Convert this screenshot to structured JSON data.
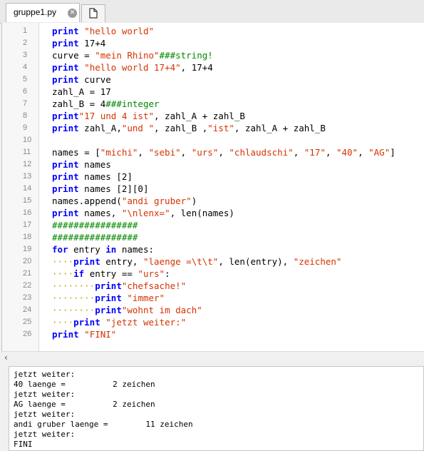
{
  "tabs": [
    {
      "label": "gruppe1.py",
      "close_icon": "close-icon"
    }
  ],
  "new_tab_icon": "new-document-icon",
  "editor": {
    "lines": [
      {
        "n": "1",
        "indent": "",
        "tokens": [
          [
            "kw",
            "print"
          ],
          [
            "pl",
            " "
          ],
          [
            "str",
            "\"hello world\""
          ]
        ]
      },
      {
        "n": "2",
        "indent": "",
        "tokens": [
          [
            "kw",
            "print"
          ],
          [
            "pl",
            " 17+4"
          ]
        ]
      },
      {
        "n": "3",
        "indent": "",
        "tokens": [
          [
            "pl",
            "curve = "
          ],
          [
            "str",
            "\"mein Rhino\""
          ],
          [
            "cmt",
            "###string!"
          ]
        ]
      },
      {
        "n": "4",
        "indent": "",
        "tokens": [
          [
            "kw",
            "print"
          ],
          [
            "pl",
            " "
          ],
          [
            "str",
            "\"hello world 17+4\""
          ],
          [
            "pl",
            ", 17+4"
          ]
        ]
      },
      {
        "n": "5",
        "indent": "",
        "tokens": [
          [
            "kw",
            "print"
          ],
          [
            "pl",
            " curve"
          ]
        ]
      },
      {
        "n": "6",
        "indent": "",
        "tokens": [
          [
            "pl",
            "zahl_A = 17"
          ]
        ]
      },
      {
        "n": "7",
        "indent": "",
        "tokens": [
          [
            "pl",
            "zahl_B = 4"
          ],
          [
            "cmt",
            "###integer"
          ]
        ]
      },
      {
        "n": "8",
        "indent": "",
        "tokens": [
          [
            "kw",
            "print"
          ],
          [
            "str",
            "\"17 und 4 ist\""
          ],
          [
            "pl",
            ", zahl_A + zahl_B"
          ]
        ]
      },
      {
        "n": "9",
        "indent": "",
        "tokens": [
          [
            "kw",
            "print"
          ],
          [
            "pl",
            " zahl_A,"
          ],
          [
            "str",
            "\"und \""
          ],
          [
            "pl",
            ", zahl_B ,"
          ],
          [
            "str",
            "\"ist\""
          ],
          [
            "pl",
            ", zahl_A + zahl_B"
          ]
        ]
      },
      {
        "n": "10",
        "indent": "",
        "tokens": []
      },
      {
        "n": "11",
        "indent": "",
        "tokens": [
          [
            "pl",
            "names = ["
          ],
          [
            "str",
            "\"michi\""
          ],
          [
            "pl",
            ", "
          ],
          [
            "str",
            "\"sebi\""
          ],
          [
            "pl",
            ", "
          ],
          [
            "str",
            "\"urs\""
          ],
          [
            "pl",
            ", "
          ],
          [
            "str",
            "\"chlaudschi\""
          ],
          [
            "pl",
            ", "
          ],
          [
            "str",
            "\"17\""
          ],
          [
            "pl",
            ", "
          ],
          [
            "str",
            "\"40\""
          ],
          [
            "pl",
            ", "
          ],
          [
            "str",
            "\"AG\""
          ],
          [
            "pl",
            "]"
          ]
        ]
      },
      {
        "n": "12",
        "indent": "",
        "tokens": [
          [
            "kw",
            "print"
          ],
          [
            "pl",
            " names"
          ]
        ]
      },
      {
        "n": "13",
        "indent": "",
        "tokens": [
          [
            "kw",
            "print"
          ],
          [
            "pl",
            " names [2]"
          ]
        ]
      },
      {
        "n": "14",
        "indent": "",
        "tokens": [
          [
            "kw",
            "print"
          ],
          [
            "pl",
            " names [2][0]"
          ]
        ]
      },
      {
        "n": "15",
        "indent": "",
        "tokens": [
          [
            "pl",
            "names.append("
          ],
          [
            "str",
            "\"andi gruber\""
          ],
          [
            "pl",
            ")"
          ]
        ]
      },
      {
        "n": "16",
        "indent": "",
        "tokens": [
          [
            "kw",
            "print"
          ],
          [
            "pl",
            " names, "
          ],
          [
            "str",
            "\"\\nlenx=\""
          ],
          [
            "pl",
            ", len(names)"
          ]
        ]
      },
      {
        "n": "17",
        "indent": "",
        "tokens": [
          [
            "cmt",
            "################"
          ]
        ]
      },
      {
        "n": "18",
        "indent": "",
        "tokens": [
          [
            "cmt",
            "################"
          ]
        ]
      },
      {
        "n": "19",
        "indent": "",
        "tokens": [
          [
            "kw",
            "for"
          ],
          [
            "pl",
            " entry "
          ],
          [
            "kw",
            "in"
          ],
          [
            "pl",
            " names:"
          ]
        ]
      },
      {
        "n": "20",
        "indent": "····",
        "tokens": [
          [
            "kw",
            "print"
          ],
          [
            "pl",
            " entry, "
          ],
          [
            "str",
            "\"laenge =\\t\\t\""
          ],
          [
            "pl",
            ", len(entry), "
          ],
          [
            "str",
            "\"zeichen\""
          ]
        ]
      },
      {
        "n": "21",
        "indent": "····",
        "tokens": [
          [
            "kw",
            "if"
          ],
          [
            "pl",
            " entry == "
          ],
          [
            "str",
            "\"urs\""
          ],
          [
            "pl",
            ":"
          ]
        ]
      },
      {
        "n": "22",
        "indent": "········",
        "tokens": [
          [
            "kw",
            "print"
          ],
          [
            "str",
            "\"chefsache!\""
          ]
        ]
      },
      {
        "n": "23",
        "indent": "········",
        "tokens": [
          [
            "kw",
            "print"
          ],
          [
            "pl",
            " "
          ],
          [
            "str",
            "\"immer\""
          ]
        ]
      },
      {
        "n": "24",
        "indent": "········",
        "tokens": [
          [
            "kw",
            "print"
          ],
          [
            "str",
            "\"wohnt im dach\""
          ]
        ]
      },
      {
        "n": "25",
        "indent": "····",
        "tokens": [
          [
            "kw",
            "print"
          ],
          [
            "pl",
            " "
          ],
          [
            "str",
            "\"jetzt weiter:\""
          ]
        ]
      },
      {
        "n": "26",
        "indent": "",
        "tokens": [
          [
            "kw",
            "print"
          ],
          [
            "pl",
            " "
          ],
          [
            "str",
            "\"FINI\""
          ]
        ]
      }
    ]
  },
  "scroll_left_icon": "chevron-left-icon",
  "output": {
    "lines": [
      "jetzt weiter:",
      "40 laenge =          2 zeichen",
      "jetzt weiter:",
      "AG laenge =          2 zeichen",
      "jetzt weiter:",
      "andi gruber laenge =        11 zeichen",
      "jetzt weiter:",
      "FINI"
    ]
  }
}
